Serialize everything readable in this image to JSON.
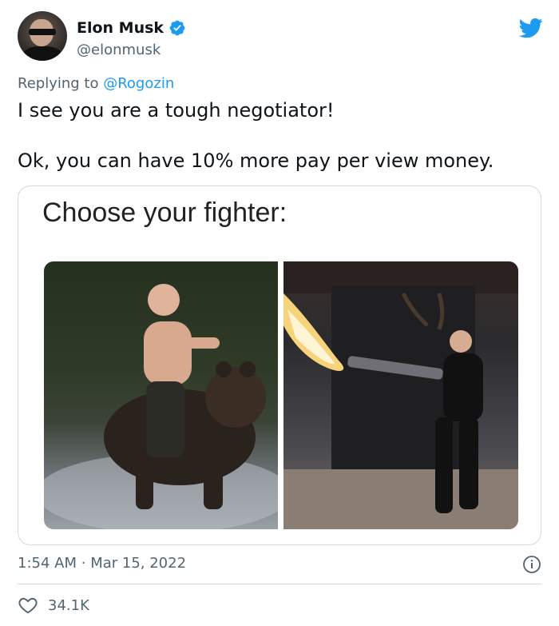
{
  "author": {
    "display_name": "Elon Musk",
    "handle": "@elonmusk",
    "avatar_icon": "avatar-photo",
    "verified_icon": "verified-badge-icon"
  },
  "brand": {
    "icon": "twitter-bird-icon",
    "color": "#1d9bf0"
  },
  "reply": {
    "prefix": "Replying to",
    "mention": "@Rogozin"
  },
  "tweet": {
    "lines": [
      "I see you are a tough negotiator!",
      "Ok, you can have 10% more pay per view money."
    ]
  },
  "media": {
    "caption": "Choose your fighter:"
  },
  "meta": {
    "time": "1:54 AM",
    "separator": "·",
    "date": "Mar 15, 2022",
    "info_icon": "info-icon"
  },
  "stats": {
    "likes": "34.1K",
    "like_icon": "heart-icon"
  },
  "colors": {
    "text": "#0f1419",
    "secondary": "#536471",
    "link": "#1d9bf0",
    "border": "#cfd9de"
  }
}
